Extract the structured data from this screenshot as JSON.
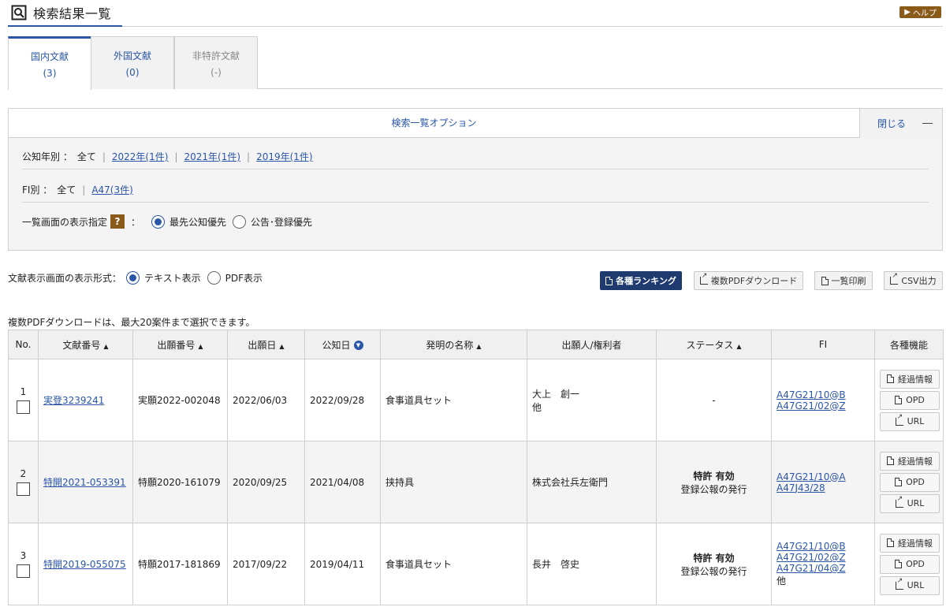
{
  "header": {
    "title": "検索結果一覧",
    "help_label": "ヘルプ"
  },
  "tabs": [
    {
      "label": "国内文献",
      "count": "(3)"
    },
    {
      "label": "外国文献",
      "count": "(0)"
    },
    {
      "label": "非特許文献",
      "count": "(-)"
    }
  ],
  "options": {
    "title": "検索一覧オプション",
    "close_label": "閉じる",
    "year_label": "公知年別 ：",
    "year_all": "全て",
    "years": [
      "2022年(1件)",
      "2021年(1件)",
      "2019年(1件)"
    ],
    "fi_label": "FI別 ：",
    "fi_all": "全て",
    "fi_items": [
      "A47(3件)"
    ],
    "display_label": "一覧画面の表示指定",
    "help_mark": "?",
    "colon": "：",
    "display_options": [
      "最先公知優先",
      "公告･登録優先"
    ],
    "display_selected": 0
  },
  "format": {
    "label": "文献表示画面の表示形式：",
    "options": [
      "テキスト表示",
      "PDF表示"
    ],
    "selected": 0
  },
  "actions": {
    "ranking": "各種ランキング",
    "multi_pdf": "複数PDFダウンロード",
    "print_list": "一覧印刷",
    "csv": "CSV出力"
  },
  "note": "複数PDFダウンロードは、最大20案件まで選択できます。",
  "table": {
    "headers": [
      "No.",
      "文献番号",
      "出願番号",
      "出願日",
      "公知日",
      "発明の名称",
      "出願人/権利者",
      "ステータス",
      "FI",
      "各種機能"
    ],
    "function_labels": [
      "経過情報",
      "OPD",
      "URL"
    ],
    "rows": [
      {
        "no": "1",
        "doc": "実登3239241",
        "app_no": "実願2022-002048",
        "app_date": "2022/06/03",
        "pub_date": "2022/09/28",
        "title": "食事道具セット",
        "applicant1": "大上　創一",
        "applicant2": "他",
        "status_main": "",
        "status_sub": "-",
        "fi": [
          "A47G21/10@B",
          "A47G21/02@Z"
        ],
        "fi_more": ""
      },
      {
        "no": "2",
        "doc": "特開2021-053391",
        "app_no": "特願2020-161079",
        "app_date": "2020/09/25",
        "pub_date": "2021/04/08",
        "title": "挟持具",
        "applicant1": "株式会社兵左衛門",
        "applicant2": "",
        "status_main": "特許 有効",
        "status_sub": "登録公報の発行",
        "fi": [
          "A47G21/10@A",
          "A47J43/28"
        ],
        "fi_more": ""
      },
      {
        "no": "3",
        "doc": "特開2019-055075",
        "app_no": "特願2017-181869",
        "app_date": "2017/09/22",
        "pub_date": "2019/04/11",
        "title": "食事道具セット",
        "applicant1": "長井　啓史",
        "applicant2": "",
        "status_main": "特許 有効",
        "status_sub": "登録公報の発行",
        "fi": [
          "A47G21/10@B",
          "A47G21/02@Z",
          "A47G21/04@Z"
        ],
        "fi_more": "他"
      }
    ]
  }
}
